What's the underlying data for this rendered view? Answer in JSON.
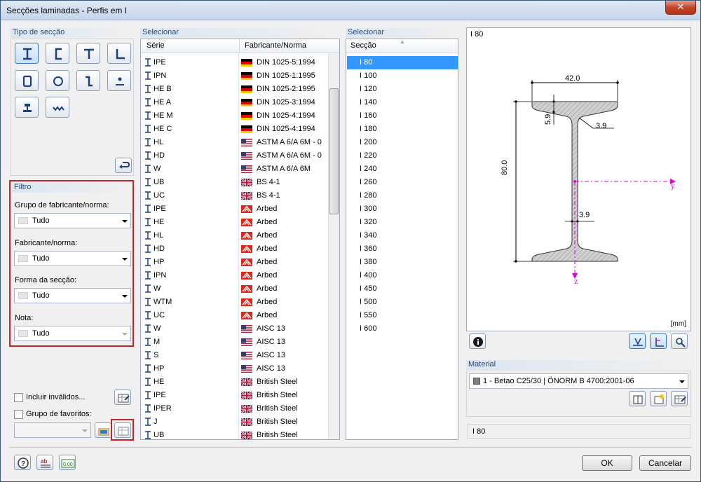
{
  "window": {
    "title": "Secções laminadas - Perfis em I",
    "close_label": "✕"
  },
  "section_type": {
    "header": "Tipo de secção",
    "buttons": [
      {
        "name": "i-section-icon"
      },
      {
        "name": "channel-section-icon"
      },
      {
        "name": "t-section-icon"
      },
      {
        "name": "angle-section-icon"
      },
      {
        "name": "rect-hollow-icon"
      },
      {
        "name": "circle-hollow-icon"
      },
      {
        "name": "z-section-icon"
      },
      {
        "name": "round-bar-icon"
      },
      {
        "name": "rail-section-icon"
      },
      {
        "name": "corrugated-section-icon"
      }
    ]
  },
  "filter": {
    "header": "Filtro",
    "group_label": "Grupo de fabricante/norma:",
    "group_value": "Tudo",
    "manufacturer_label": "Fabricante/norma:",
    "manufacturer_value": "Tudo",
    "shape_label": "Forma da secção:",
    "shape_value": "Tudo",
    "note_label": "Nota:",
    "note_value": "Tudo"
  },
  "options": {
    "include_invalid": "Incluir inválidos...",
    "favorites_group": "Grupo de favoritos:"
  },
  "series_list": {
    "header": "Selecionar",
    "col_series": "Série",
    "col_manufacturer": "Fabricante/Norma",
    "rows": [
      {
        "series": "IPE",
        "flag": "de",
        "manufacturer": "DIN 1025-5:1994"
      },
      {
        "series": "IPN",
        "flag": "de",
        "manufacturer": "DIN 1025-1:1995"
      },
      {
        "series": "HE B",
        "flag": "de",
        "manufacturer": "DIN 1025-2:1995"
      },
      {
        "series": "HE A",
        "flag": "de",
        "manufacturer": "DIN 1025-3:1994"
      },
      {
        "series": "HE M",
        "flag": "de",
        "manufacturer": "DIN 1025-4:1994"
      },
      {
        "series": "HE C",
        "flag": "de",
        "manufacturer": "DIN 1025-4:1994"
      },
      {
        "series": "HL",
        "flag": "us",
        "manufacturer": "ASTM A 6/A 6M - 0"
      },
      {
        "series": "HD",
        "flag": "us",
        "manufacturer": "ASTM A 6/A 6M - 0"
      },
      {
        "series": "W",
        "flag": "us",
        "manufacturer": "ASTM A 6/A 6M"
      },
      {
        "series": "UB",
        "flag": "uk",
        "manufacturer": "BS 4-1"
      },
      {
        "series": "UC",
        "flag": "uk",
        "manufacturer": "BS 4-1"
      },
      {
        "series": "IPE",
        "flag": "arbed",
        "manufacturer": "Arbed"
      },
      {
        "series": "HE",
        "flag": "arbed",
        "manufacturer": "Arbed"
      },
      {
        "series": "HL",
        "flag": "arbed",
        "manufacturer": "Arbed"
      },
      {
        "series": "HD",
        "flag": "arbed",
        "manufacturer": "Arbed"
      },
      {
        "series": "HP",
        "flag": "arbed",
        "manufacturer": "Arbed"
      },
      {
        "series": "IPN",
        "flag": "arbed",
        "manufacturer": "Arbed"
      },
      {
        "series": "W",
        "flag": "arbed",
        "manufacturer": "Arbed"
      },
      {
        "series": "WTM",
        "flag": "arbed",
        "manufacturer": "Arbed"
      },
      {
        "series": "UC",
        "flag": "arbed",
        "manufacturer": "Arbed"
      },
      {
        "series": "W",
        "flag": "us",
        "manufacturer": "AISC 13"
      },
      {
        "series": "M",
        "flag": "us",
        "manufacturer": "AISC 13"
      },
      {
        "series": "S",
        "flag": "us",
        "manufacturer": "AISC 13"
      },
      {
        "series": "HP",
        "flag": "us",
        "manufacturer": "AISC 13"
      },
      {
        "series": "HE",
        "flag": "uk",
        "manufacturer": "British Steel"
      },
      {
        "series": "IPE",
        "flag": "uk",
        "manufacturer": "British Steel"
      },
      {
        "series": "IPER",
        "flag": "uk",
        "manufacturer": "British Steel"
      },
      {
        "series": "J",
        "flag": "uk",
        "manufacturer": "British Steel"
      },
      {
        "series": "UB",
        "flag": "uk",
        "manufacturer": "British Steel"
      }
    ]
  },
  "section_list": {
    "header": "Selecionar",
    "col_section": "Secção",
    "selected": "I 80",
    "rows": [
      "I 80",
      "I 100",
      "I 120",
      "I 140",
      "I 160",
      "I 180",
      "I 200",
      "I 220",
      "I 240",
      "I 260",
      "I 280",
      "I 300",
      "I 320",
      "I 340",
      "I 360",
      "I 380",
      "I 400",
      "I 450",
      "I 500",
      "I 550",
      "I 600"
    ]
  },
  "drawing": {
    "title": "I 80",
    "unit": "[mm]",
    "dim_width": "42.0",
    "dim_height": "80.0",
    "dim_flange": "5.9",
    "dim_radius": "3.9",
    "dim_web": "3.9",
    "axis_y": "y",
    "axis_z": "z"
  },
  "material": {
    "header": "Material",
    "value": "1 - Betao C25/30 | ÖNORM B 4700:2001-06",
    "swatch_color": "#808080"
  },
  "status": {
    "text": "I 80"
  },
  "footer": {
    "ok": "OK",
    "cancel": "Cancelar"
  },
  "colors": {
    "selection": "#3399ff",
    "highlight_frame": "#c0272d",
    "axis": "#e000e0"
  }
}
